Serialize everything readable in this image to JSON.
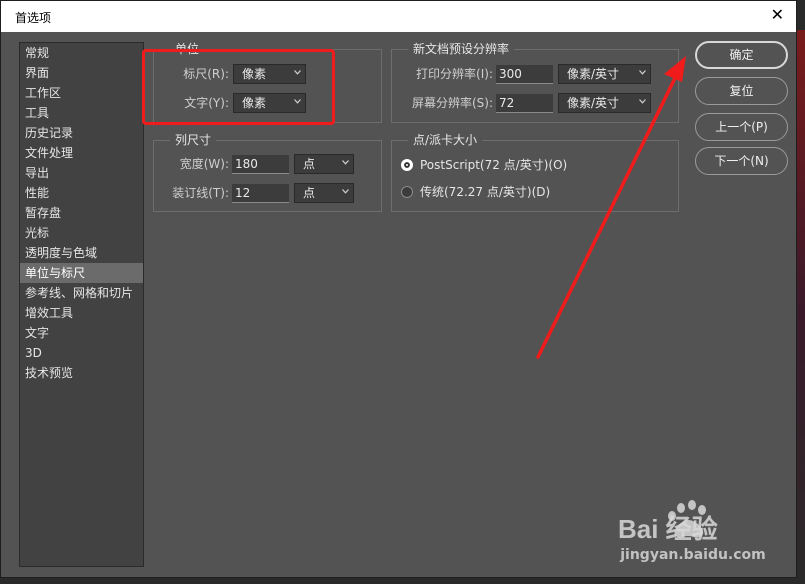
{
  "dialog": {
    "title": "首选项",
    "close_symbol": "✕"
  },
  "sidebar": {
    "items": [
      {
        "label": "常规"
      },
      {
        "label": "界面"
      },
      {
        "label": "工作区"
      },
      {
        "label": "工具"
      },
      {
        "label": "历史记录"
      },
      {
        "label": "文件处理"
      },
      {
        "label": "导出"
      },
      {
        "label": "性能"
      },
      {
        "label": "暂存盘"
      },
      {
        "label": "光标"
      },
      {
        "label": "透明度与色域"
      },
      {
        "label": "单位与标尺",
        "selected": true
      },
      {
        "label": "参考线、网格和切片"
      },
      {
        "label": "增效工具"
      },
      {
        "label": "文字"
      },
      {
        "label": "3D"
      },
      {
        "label": "技术预览"
      }
    ]
  },
  "units": {
    "group_label": "单位",
    "rulers_label": "标尺(R):",
    "rulers_value": "像素",
    "type_label": "文字(Y):",
    "type_value": "像素"
  },
  "column_size": {
    "group_label": "列尺寸",
    "width_label": "宽度(W):",
    "width_value": "180",
    "width_unit": "点",
    "gutter_label": "装订线(T):",
    "gutter_value": "12",
    "gutter_unit": "点"
  },
  "new_doc_resolution": {
    "group_label": "新文档预设分辨率",
    "print_label": "打印分辨率(I):",
    "print_value": "300",
    "print_unit": "像素/英寸",
    "screen_label": "屏幕分辨率(S):",
    "screen_value": "72",
    "screen_unit": "像素/英寸"
  },
  "point_pica": {
    "group_label": "点/派卡大小",
    "option_postscript": "PostScript(72 点/英寸)(O)",
    "option_traditional": "传统(72.27 点/英寸)(D)",
    "selected": "postscript"
  },
  "buttons": {
    "ok": "确定",
    "reset": "复位",
    "prev": "上一个(P)",
    "next": "下一个(N)"
  },
  "watermark": {
    "text": "jingyan.baidu.com",
    "brand": "Bai 经验"
  },
  "colors": {
    "annotation_red": "#f01c1c",
    "dialog_bg": "#535353"
  }
}
